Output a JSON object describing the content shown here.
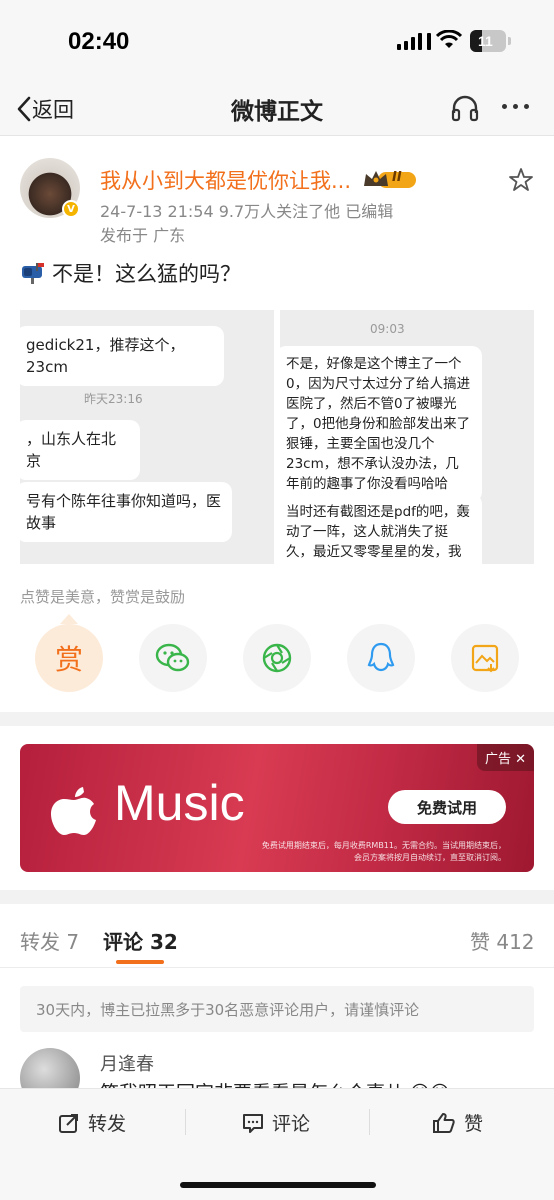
{
  "status_bar": {
    "time": "02:40",
    "battery": "11",
    "battery_fraction": 0.11
  },
  "nav": {
    "back_label": "返回",
    "title": "微博正文",
    "headphones_icon": "headphones-icon",
    "more_icon": "more-dots-icon"
  },
  "post": {
    "author": "我从小到大都是优你让我...",
    "level_badge": "II",
    "meta": "24-7-13 21:54  9.7万人关注了他  已编辑",
    "location": "发布于 广东",
    "text": "不是！这么猛的吗？",
    "images": {
      "left": {
        "line1": "gedick21，推荐这个，23cm",
        "timestamp": "昨天23:16",
        "line2": "，山东人在北京",
        "line3a": "号有个陈年往事你知道吗，医",
        "line3b": "故事"
      },
      "right": {
        "timestamp": "09:03",
        "para1": "不是，好像是这个博主了一个0，因为尺寸太过分了给人搞进医院了，然后不管0了被曝光了，0把他身份和脸部发出来了狠锤，主要全国也没几个23cm，想不承认没办法，几年前的趣事了你没看吗哈哈",
        "para2": "当时还有截图还是pdf的吧，轰动了一阵，这人就消失了挺久，最近又零零星星的发，我朋友约过他，说能试一次这种进医院也不亏..."
      }
    },
    "reward_hint": "点赞是美意，赞赏是鼓励",
    "reward_label": "赏",
    "share_icons": [
      "wechat-icon",
      "moments-icon",
      "qq-icon",
      "save-image-icon"
    ]
  },
  "ad": {
    "brand": "Music",
    "tag": "广告 ✕",
    "cta": "免费试用",
    "fine_print_1": "免费试用期结束后，每月收费RMB11。无需合约。当试用期结束后，",
    "fine_print_2": "会员方案将按月自动续订，直至取消订阅。"
  },
  "tabs": {
    "repost": "转发 7",
    "comment": "评论 32",
    "like": "赞 412"
  },
  "notice": "30天内，博主已拉黑多于30名恶意评论用户，请谨慎评论",
  "comment": {
    "name": "月逢春",
    "text": "笑我昭王回宫非要看看是怎么个事儿 😅😅"
  },
  "bottom_bar": {
    "repost": "转发",
    "comment": "评论",
    "like": "赞"
  }
}
